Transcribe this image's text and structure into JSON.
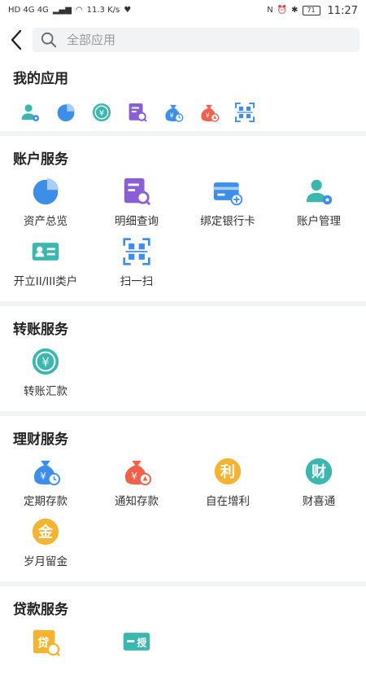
{
  "status_bar": {
    "left_text": "HD 4G 4G",
    "speed": "11.3 K/s",
    "battery": "71",
    "time": "11:27"
  },
  "search": {
    "placeholder": "全部应用"
  },
  "my_apps": {
    "title": "我的应用",
    "icons": [
      "account-manage-icon",
      "asset-pie-icon",
      "yuan-transfer-icon",
      "detail-query-icon",
      "fixed-deposit-icon",
      "notice-deposit-icon",
      "scan-icon"
    ]
  },
  "account_services": {
    "title": "账户服务",
    "items": [
      {
        "label": "资产总览",
        "icon": "asset-pie-icon"
      },
      {
        "label": "明细查询",
        "icon": "detail-query-icon"
      },
      {
        "label": "绑定银行卡",
        "icon": "bind-card-icon"
      },
      {
        "label": "账户管理",
        "icon": "account-manage-icon"
      },
      {
        "label": "开立II/III类户",
        "icon": "open-account-icon"
      },
      {
        "label": "扫一扫",
        "icon": "scan-icon"
      }
    ]
  },
  "transfer_services": {
    "title": "转账服务",
    "items": [
      {
        "label": "转账汇款",
        "icon": "yuan-transfer-icon"
      }
    ]
  },
  "wealth_services": {
    "title": "理财服务",
    "items": [
      {
        "label": "定期存款",
        "icon": "fixed-deposit-icon"
      },
      {
        "label": "通知存款",
        "icon": "notice-deposit-icon"
      },
      {
        "label": "自在增利",
        "icon": "li-profit-icon"
      },
      {
        "label": "财喜通",
        "icon": "cai-icon"
      },
      {
        "label": "岁月留金",
        "icon": "jin-gold-icon"
      }
    ]
  },
  "loan_services": {
    "title": "贷款服务",
    "items": [
      {
        "label": "",
        "icon": "loan-calendar-icon"
      },
      {
        "label": "",
        "icon": "loan-card-icon"
      }
    ]
  },
  "colors": {
    "blue": "#3d8ee8",
    "teal": "#3bb7b0",
    "purple": "#8a5fd6",
    "orange": "#f0604a",
    "yellow": "#f2b431"
  }
}
